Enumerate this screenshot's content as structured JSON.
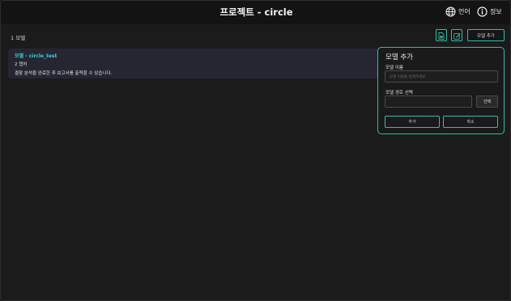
{
  "header": {
    "title": "프로젝트 - circle",
    "language_label": "언어",
    "info_label": "정보"
  },
  "toolbar": {
    "model_count": "1 모델",
    "add_model_label": "모델 추가"
  },
  "models": [
    {
      "name": "모델 - circle_test",
      "chapters": "2 챕처",
      "description": "결함 분석을 완료한 후 보고서를 출력할 수 있습니다."
    }
  ],
  "add_model_popover": {
    "title": "모델 추가",
    "name_label": "모델 이름",
    "name_placeholder": "모델 이름을 입력하세요.",
    "name_value": "",
    "path_label": "모델 경로 선택",
    "path_value": "",
    "select_label": "선택",
    "add_label": "추가",
    "cancel_label": "취소"
  },
  "colors": {
    "accent": "#2dbfad",
    "model_name": "#37d6d6",
    "card_bg": "#262633",
    "header_bg": "#131313",
    "page_bg": "#1b1b1b"
  }
}
